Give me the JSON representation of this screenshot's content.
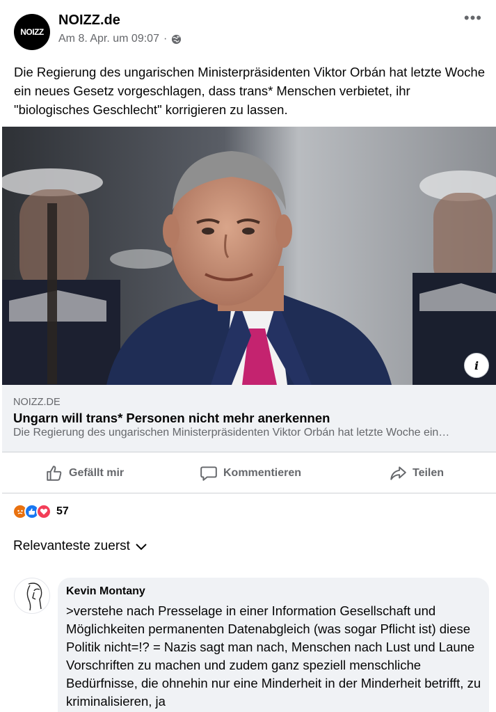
{
  "post": {
    "page_name": "NOIZZ.de",
    "avatar_text": "NOIZZ",
    "timestamp": "Am 8. Apr. um 09:07",
    "separator": "·",
    "privacy_icon": "globe-icon",
    "more_label": "•••",
    "text": "Die Regierung des ungarischen Ministerpräsidenten Viktor Orbán hat letzte Woche ein neues Gesetz vorgeschlagen, dass trans* Menschen verbietet, ihr \"biologisches Geschlecht\" korrigieren zu lassen."
  },
  "link": {
    "domain": "NOIZZ.DE",
    "title": "Ungarn will trans* Personen nicht mehr anerkennen",
    "description": "Die Regierung des ungarischen Ministerpräsidenten Viktor Orbán hat letzte Woche ein…",
    "info_label": "i"
  },
  "actions": {
    "like": "Gefällt mir",
    "comment": "Kommentieren",
    "share": "Teilen"
  },
  "reactions": {
    "types": [
      "angry",
      "like",
      "love"
    ],
    "count": "57"
  },
  "comments": {
    "sort_label": "Relevanteste zuerst",
    "items": [
      {
        "author": "Kevin Montany",
        "text": ">verstehe nach Presselage in einer Information Gesellschaft und Möglichkeiten permanenten Datenabgleich (was sogar Pflicht ist) diese Politik nicht=!? = Nazis sagt man nach, Menschen  nach Lust und Laune Vorschriften zu machen und zudem ganz speziell menschliche Bedürfnisse, die ohnehin nur eine Minderheit in der Minderheit betrifft, zu kriminalisieren, ja"
      }
    ]
  },
  "colors": {
    "secondary_text": "#65676b",
    "bubble_bg": "#f0f2f5",
    "divider": "#ced0d4",
    "tie": "#c4236f",
    "suit": "#1f2d55"
  }
}
